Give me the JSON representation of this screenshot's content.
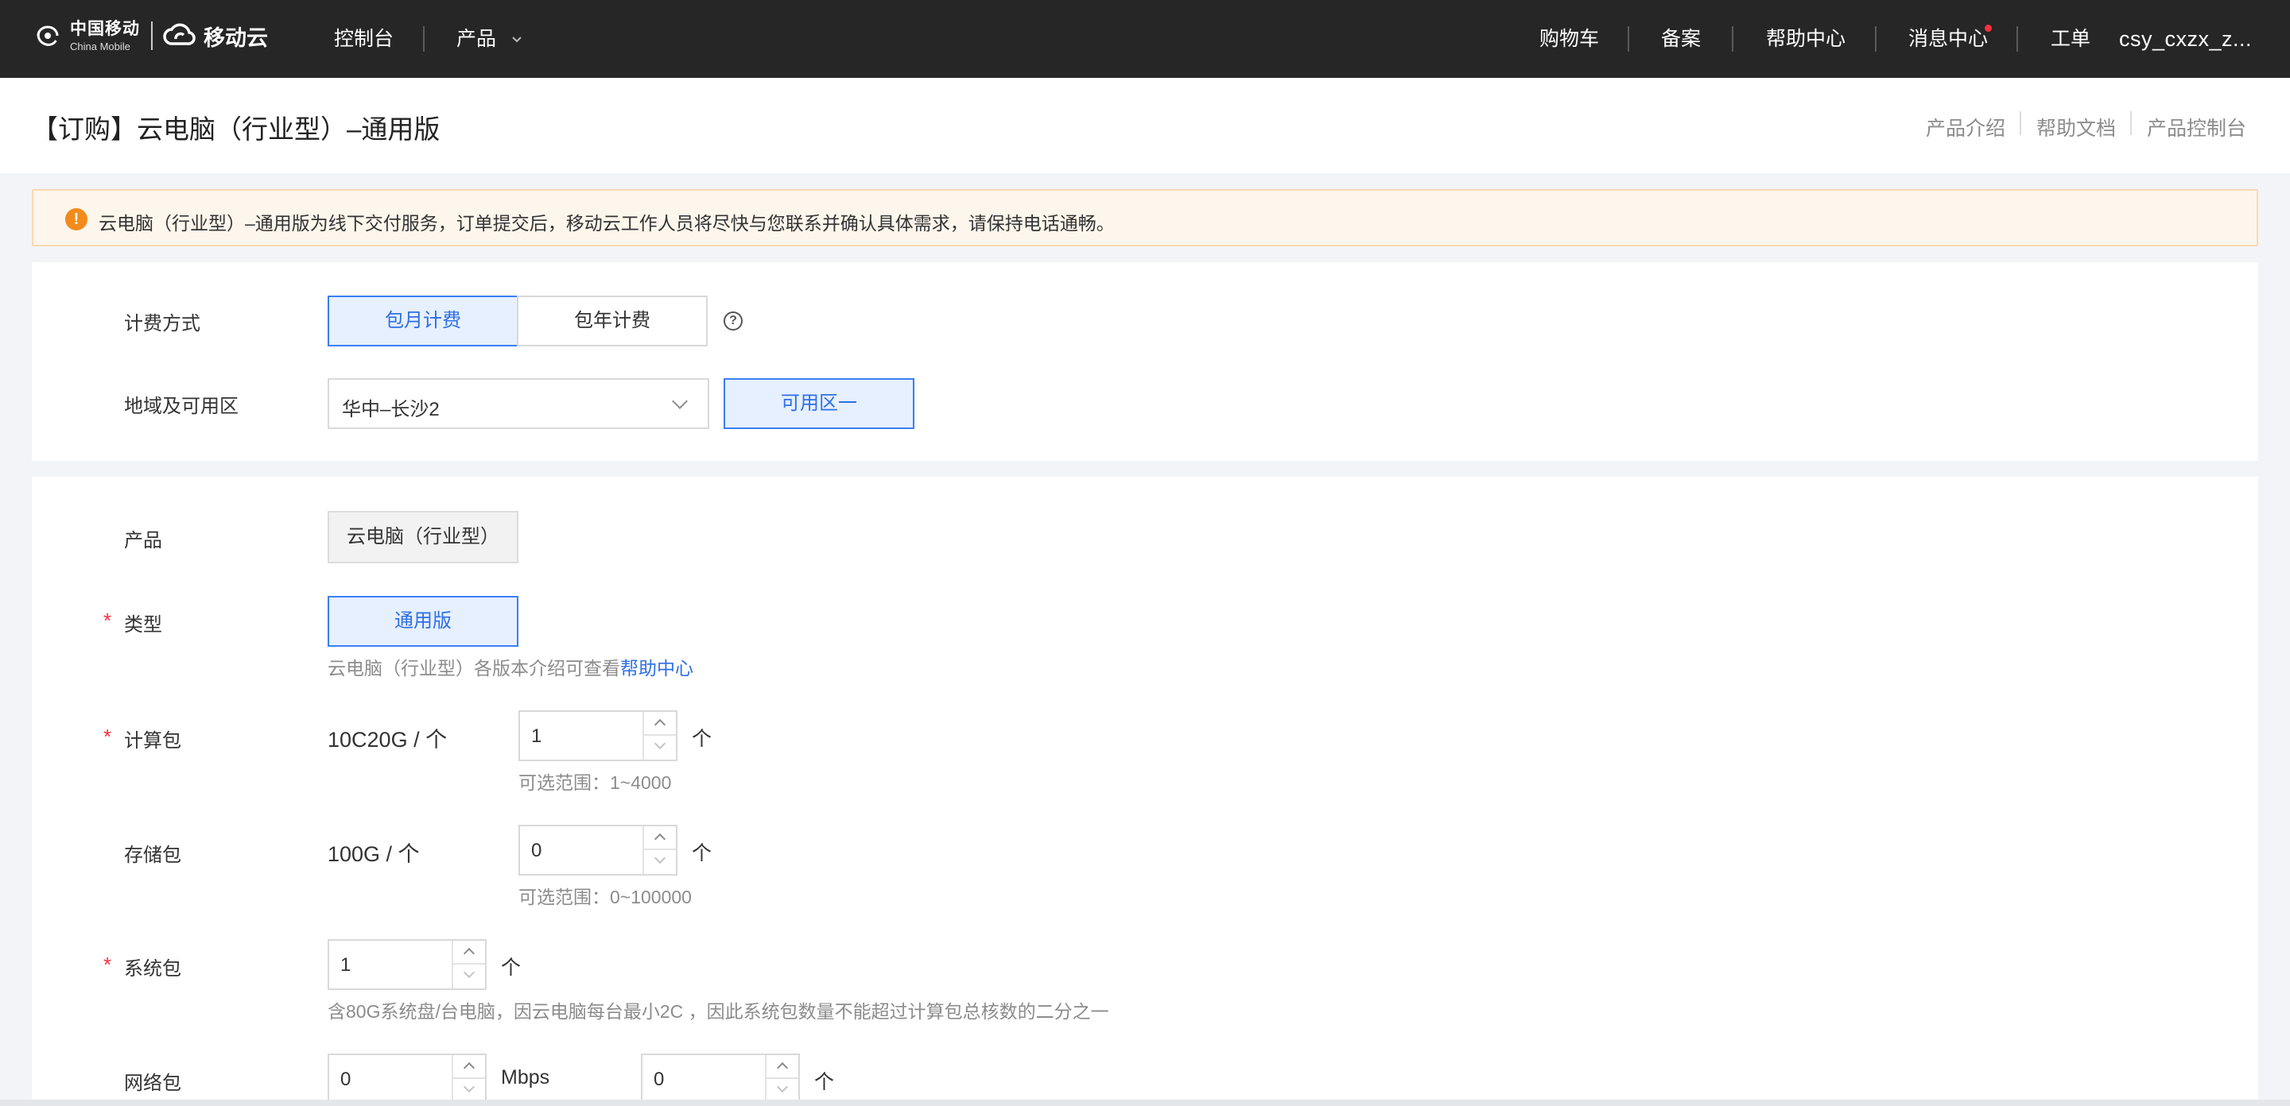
{
  "topbar": {
    "logo_cm_cn": "中国移动",
    "logo_cm_en": "China Mobile",
    "logo_yd": "移动云",
    "console": "控制台",
    "products": "产品",
    "cart": "购物车",
    "icp": "备案",
    "help_center": "帮助中心",
    "messages": "消息中心",
    "tickets": "工单",
    "user": "csy_cxzx_z..."
  },
  "titlebar": {
    "title": "【订购】云电脑（行业型）–通用版",
    "links": [
      "产品介绍",
      "帮助文档",
      "产品控制台"
    ]
  },
  "notice": {
    "text": "云电脑（行业型）–通用版为线下交付服务，订单提交后，移动云工作人员将尽快与您联系并确认具体需求，请保持电话通畅。"
  },
  "billing": {
    "label": "计费方式",
    "options": [
      "包月计费",
      "包年计费"
    ],
    "selected": "包月计费",
    "help": "?"
  },
  "region": {
    "label": "地域及可用区",
    "value": "华中–长沙2",
    "zone": "可用区一"
  },
  "product": {
    "label": "产品",
    "value": "云电脑（行业型）"
  },
  "type": {
    "label": "类型",
    "required": "*",
    "value": "通用版",
    "hint_prefix": "云电脑（行业型）各版本介绍可查看",
    "hint_link": "帮助中心"
  },
  "compute": {
    "label": "计算包",
    "required": "*",
    "spec": "10C20G / 个",
    "value": "1",
    "unit": "个",
    "range": "可选范围：1~4000"
  },
  "storage": {
    "label": "存储包",
    "spec": "100G / 个",
    "value": "0",
    "unit": "个",
    "range": "可选范围：0~100000"
  },
  "system": {
    "label": "系统包",
    "required": "*",
    "value": "1",
    "unit": "个",
    "hint": "含80G系统盘/台电脑，因云电脑每台最小2C ，因此系统包数量不能超过计算包总核数的二分之一"
  },
  "network": {
    "label": "网络包",
    "bandwidth_value": "0",
    "bandwidth_unit": "Mbps",
    "count_value": "0",
    "count_unit": "个"
  },
  "colors": {
    "topbar_bg": "#262626",
    "accent": "#2f6fe4",
    "warning": "#f28a1c",
    "required": "#f5333f"
  }
}
